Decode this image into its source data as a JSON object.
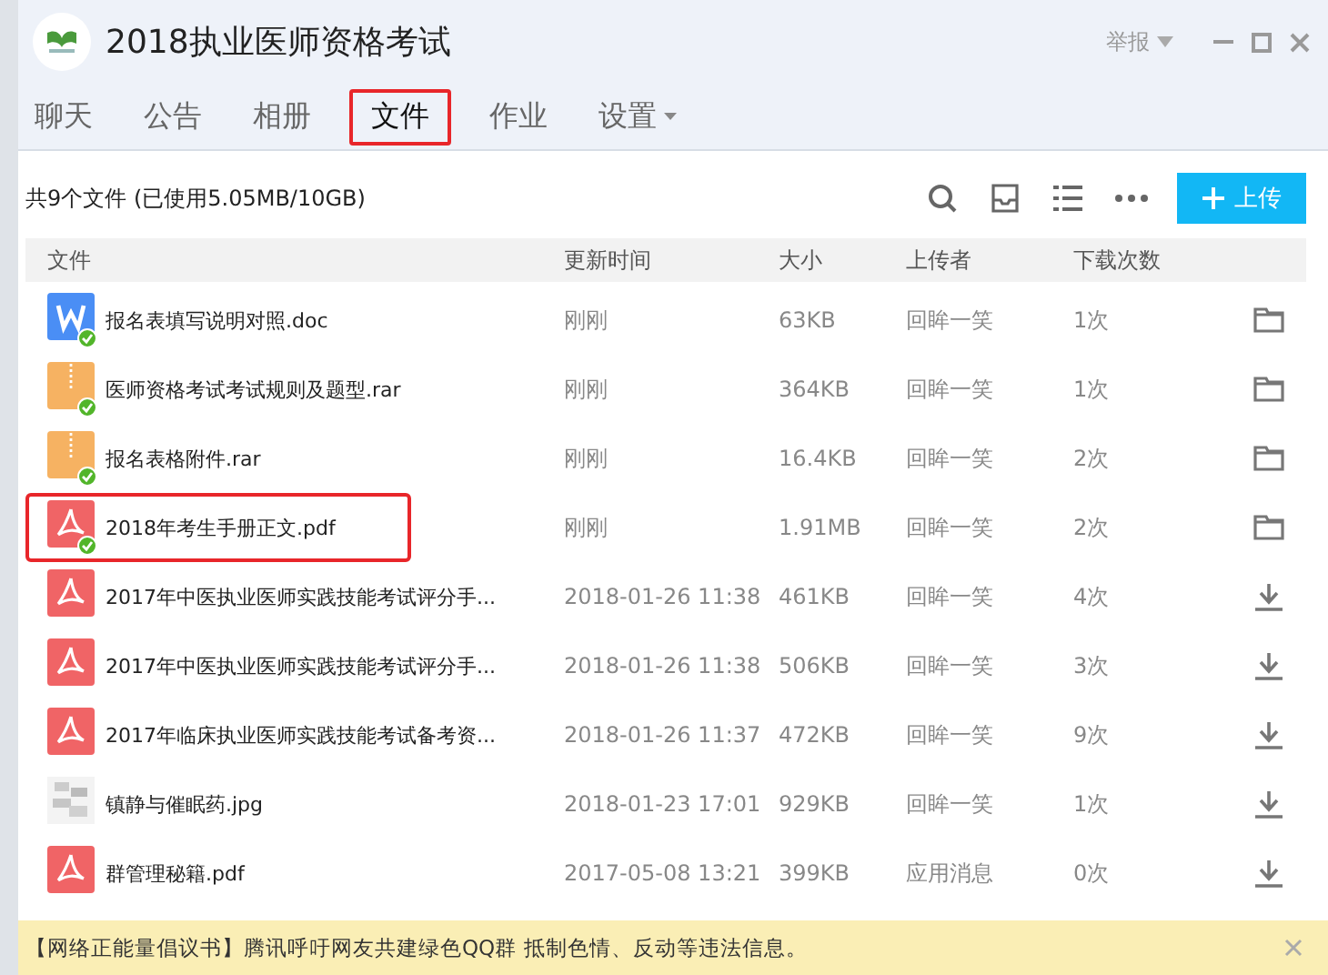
{
  "window": {
    "title": "2018执业医师资格考试",
    "report": "举报"
  },
  "tabs": [
    {
      "label": "聊天",
      "selected": false,
      "highlighted": false,
      "has_menu": false
    },
    {
      "label": "公告",
      "selected": false,
      "highlighted": false,
      "has_menu": false
    },
    {
      "label": "相册",
      "selected": false,
      "highlighted": false,
      "has_menu": false
    },
    {
      "label": "文件",
      "selected": true,
      "highlighted": true,
      "has_menu": false
    },
    {
      "label": "作业",
      "selected": false,
      "highlighted": false,
      "has_menu": false
    },
    {
      "label": "设置",
      "selected": false,
      "highlighted": false,
      "has_menu": true
    }
  ],
  "summary": "共9个文件 (已使用5.05MB/10GB)",
  "upload_button": "上传",
  "table": {
    "columns": [
      "文件",
      "更新时间",
      "大小",
      "上传者",
      "下载次数"
    ],
    "rows": [
      {
        "kind": "word",
        "name": "报名表填写说明对照.doc",
        "time": "刚刚",
        "size": "63KB",
        "uploader": "回眸一笑",
        "downloads": "1次",
        "downloaded": true,
        "highlighted": false
      },
      {
        "kind": "zip",
        "name": "医师资格考试考试规则及题型.rar",
        "time": "刚刚",
        "size": "364KB",
        "uploader": "回眸一笑",
        "downloads": "1次",
        "downloaded": true,
        "highlighted": false
      },
      {
        "kind": "zip",
        "name": "报名表格附件.rar",
        "time": "刚刚",
        "size": "16.4KB",
        "uploader": "回眸一笑",
        "downloads": "2次",
        "downloaded": true,
        "highlighted": false
      },
      {
        "kind": "pdf",
        "name": "2018年考生手册正文.pdf",
        "time": "刚刚",
        "size": "1.91MB",
        "uploader": "回眸一笑",
        "downloads": "2次",
        "downloaded": true,
        "highlighted": true
      },
      {
        "kind": "pdf",
        "name": "2017年中医执业医师实践技能考试评分手...",
        "time": "2018-01-26 11:38",
        "size": "461KB",
        "uploader": "回眸一笑",
        "downloads": "4次",
        "downloaded": false,
        "highlighted": false
      },
      {
        "kind": "pdf",
        "name": "2017年中医执业医师实践技能考试评分手...",
        "time": "2018-01-26 11:38",
        "size": "506KB",
        "uploader": "回眸一笑",
        "downloads": "3次",
        "downloaded": false,
        "highlighted": false
      },
      {
        "kind": "pdf",
        "name": "2017年临床执业医师实践技能考试备考资...",
        "time": "2018-01-26 11:37",
        "size": "472KB",
        "uploader": "回眸一笑",
        "downloads": "9次",
        "downloaded": false,
        "highlighted": false
      },
      {
        "name": "镇静与催眠药.jpg",
        "time": "2018-01-23 17:01",
        "size": "929KB",
        "uploader": "回眸一笑",
        "downloads": "1次",
        "downloaded": false,
        "highlighted": false
      },
      {
        "kind": "pdf",
        "name": "群管理秘籍.pdf",
        "time": "2017-05-08 13:21",
        "size": "399KB",
        "uploader": "应用消息",
        "downloads": "0次",
        "downloaded": false,
        "highlighted": false
      }
    ]
  },
  "notice": {
    "title": "【网络正能量倡议书】",
    "text": "腾讯呼吁网友共建绿色QQ群 抵制色情、反动等违法信息。"
  }
}
